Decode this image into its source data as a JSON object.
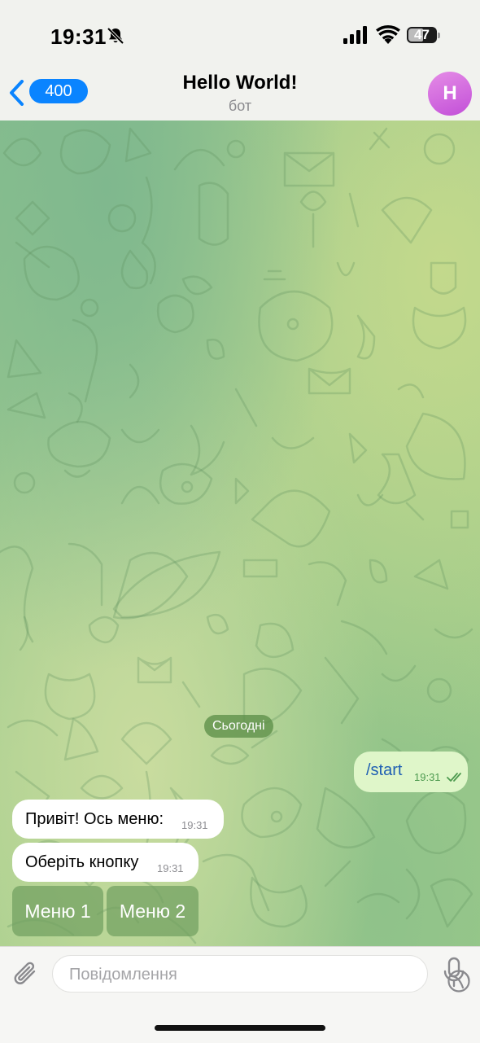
{
  "status_bar": {
    "time": "19:31",
    "battery_level": "47",
    "silent_mode": true
  },
  "nav": {
    "back_badge": "400",
    "title": "Hello World!",
    "subtitle": "бот",
    "avatar_initial": "H",
    "avatar_color": "#d36fe0"
  },
  "chat": {
    "date_separator": "Сьогодні",
    "messages": [
      {
        "direction": "outgoing",
        "text": "/start",
        "time": "19:31",
        "read": true
      },
      {
        "direction": "incoming",
        "text": "Привіт! Ось меню:",
        "time": "19:31"
      },
      {
        "direction": "incoming",
        "text": "Оберіть кнопку",
        "time": "19:31"
      }
    ],
    "keyboard_buttons": [
      "Меню 1",
      "Меню 2"
    ]
  },
  "composer": {
    "placeholder": "Повідомлення",
    "value": ""
  },
  "colors": {
    "accent": "#0a84ff",
    "outgoing_bubble": "#dff6c9",
    "incoming_bubble": "#ffffff"
  }
}
